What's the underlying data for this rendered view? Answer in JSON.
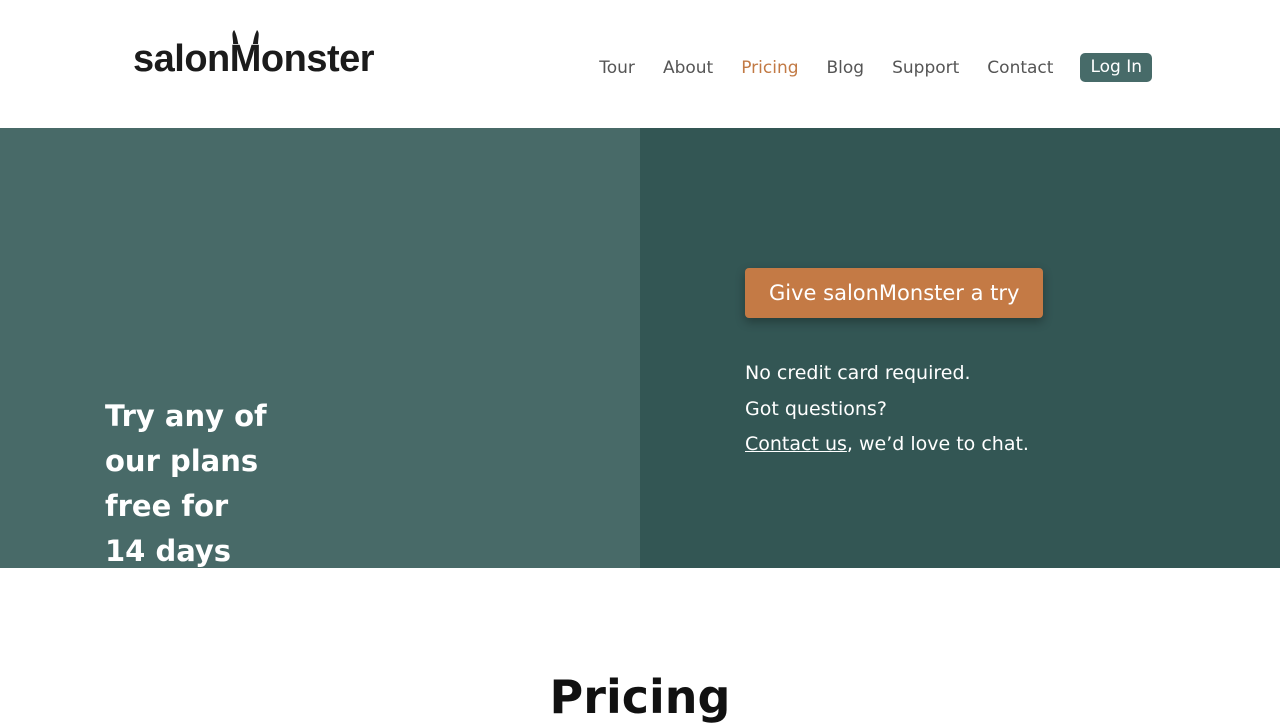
{
  "header": {
    "logo": {
      "pre": "salon",
      "m": "M",
      "post": "onster"
    },
    "nav": [
      {
        "label": "Tour"
      },
      {
        "label": "About"
      },
      {
        "label": "Pricing"
      },
      {
        "label": "Blog"
      },
      {
        "label": "Support"
      },
      {
        "label": "Contact"
      }
    ],
    "active_nav": "Pricing",
    "login_label": "Log In"
  },
  "hero": {
    "headline": "Try any of\nour plans\nfree for\n14 days",
    "cta_label": "Give salonMonster a try",
    "line1": "No credit card required.",
    "line2": "Got questions?",
    "contact_link": "Contact us",
    "contact_suffix": ", we’d love to chat."
  },
  "pricing": {
    "title": "Pricing"
  },
  "colors": {
    "accent": "#c47a45",
    "left_panel": "#486a68",
    "right_panel": "#335654",
    "login_button": "#476b69"
  }
}
